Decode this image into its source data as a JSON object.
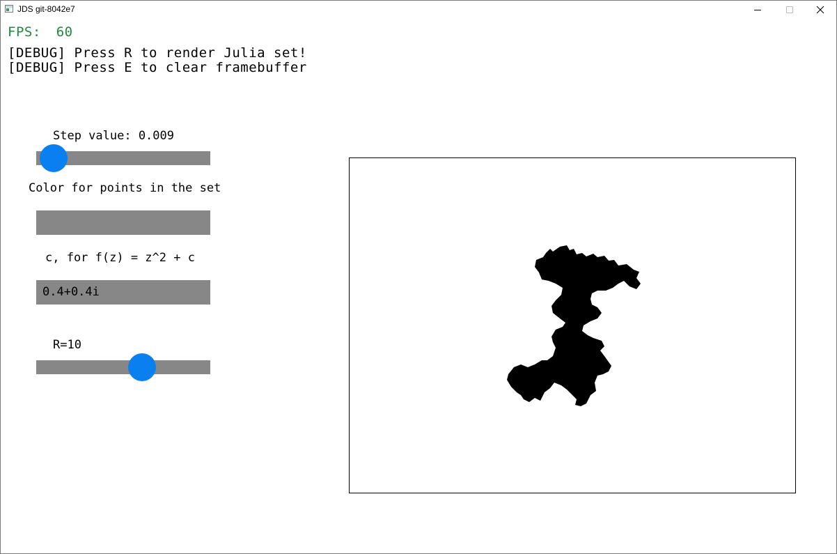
{
  "window": {
    "title": "JDS git-8042e7"
  },
  "overlay": {
    "fps_label": "FPS:",
    "fps_value": "60",
    "debug_lines": [
      "[DEBUG] Press R to render Julia set!",
      "[DEBUG] Press E to clear framebuffer"
    ]
  },
  "controls": {
    "step_label": "Step value: 0.009",
    "step_slider_fraction": 0.09,
    "color_label": "Color for points in the set",
    "color_value": "",
    "c_label": "c, for f(z) = z^2 + c",
    "c_value": "0.4+0.4i",
    "r_label": "R=10",
    "r_slider_fraction": 0.6
  },
  "colors": {
    "accent": "#0a7ff0",
    "track": "#878787",
    "fps_text": "#1f8a3a",
    "set_fill": "#000000"
  },
  "icons": {
    "app": "app-window-icon",
    "minimize": "minimize-icon",
    "maximize": "maximize-icon",
    "close": "close-icon"
  }
}
